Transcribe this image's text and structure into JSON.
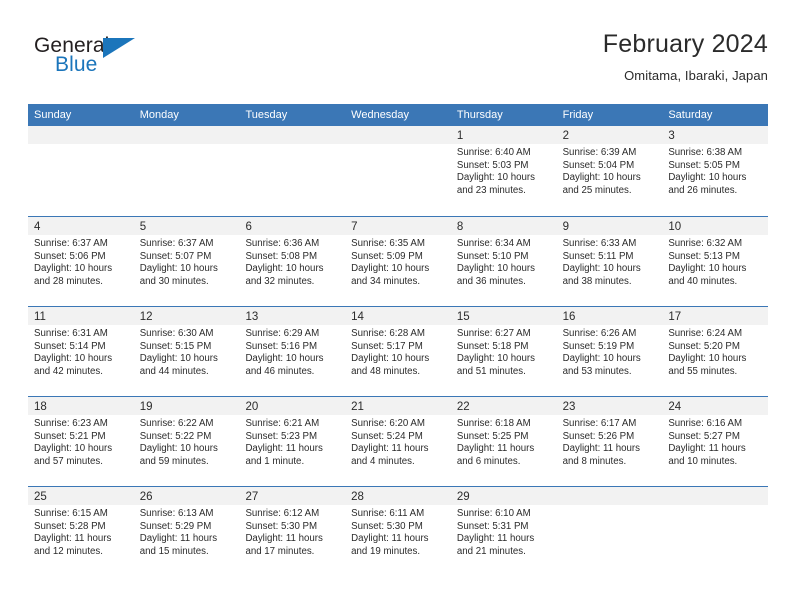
{
  "brand": {
    "name_top": "General",
    "name_bottom": "Blue",
    "triangle_icon": "brand-triangle-icon",
    "color_dark": "#231f20",
    "color_blue": "#1b75bb"
  },
  "header": {
    "title": "February 2024",
    "subtitle": "Omitama, Ibaraki, Japan"
  },
  "theme": {
    "header_blue": "#3b77b6",
    "day_band_gray": "#f2f2f2",
    "text": "#2b2b2b"
  },
  "weekdays": [
    "Sunday",
    "Monday",
    "Tuesday",
    "Wednesday",
    "Thursday",
    "Friday",
    "Saturday"
  ],
  "weeks": [
    [
      {
        "empty": true
      },
      {
        "empty": true
      },
      {
        "empty": true
      },
      {
        "empty": true
      },
      {
        "day": "1",
        "sunrise": "Sunrise: 6:40 AM",
        "sunset": "Sunset: 5:03 PM",
        "daylight": "Daylight: 10 hours and 23 minutes."
      },
      {
        "day": "2",
        "sunrise": "Sunrise: 6:39 AM",
        "sunset": "Sunset: 5:04 PM",
        "daylight": "Daylight: 10 hours and 25 minutes."
      },
      {
        "day": "3",
        "sunrise": "Sunrise: 6:38 AM",
        "sunset": "Sunset: 5:05 PM",
        "daylight": "Daylight: 10 hours and 26 minutes."
      }
    ],
    [
      {
        "day": "4",
        "sunrise": "Sunrise: 6:37 AM",
        "sunset": "Sunset: 5:06 PM",
        "daylight": "Daylight: 10 hours and 28 minutes."
      },
      {
        "day": "5",
        "sunrise": "Sunrise: 6:37 AM",
        "sunset": "Sunset: 5:07 PM",
        "daylight": "Daylight: 10 hours and 30 minutes."
      },
      {
        "day": "6",
        "sunrise": "Sunrise: 6:36 AM",
        "sunset": "Sunset: 5:08 PM",
        "daylight": "Daylight: 10 hours and 32 minutes."
      },
      {
        "day": "7",
        "sunrise": "Sunrise: 6:35 AM",
        "sunset": "Sunset: 5:09 PM",
        "daylight": "Daylight: 10 hours and 34 minutes."
      },
      {
        "day": "8",
        "sunrise": "Sunrise: 6:34 AM",
        "sunset": "Sunset: 5:10 PM",
        "daylight": "Daylight: 10 hours and 36 minutes."
      },
      {
        "day": "9",
        "sunrise": "Sunrise: 6:33 AM",
        "sunset": "Sunset: 5:11 PM",
        "daylight": "Daylight: 10 hours and 38 minutes."
      },
      {
        "day": "10",
        "sunrise": "Sunrise: 6:32 AM",
        "sunset": "Sunset: 5:13 PM",
        "daylight": "Daylight: 10 hours and 40 minutes."
      }
    ],
    [
      {
        "day": "11",
        "sunrise": "Sunrise: 6:31 AM",
        "sunset": "Sunset: 5:14 PM",
        "daylight": "Daylight: 10 hours and 42 minutes."
      },
      {
        "day": "12",
        "sunrise": "Sunrise: 6:30 AM",
        "sunset": "Sunset: 5:15 PM",
        "daylight": "Daylight: 10 hours and 44 minutes."
      },
      {
        "day": "13",
        "sunrise": "Sunrise: 6:29 AM",
        "sunset": "Sunset: 5:16 PM",
        "daylight": "Daylight: 10 hours and 46 minutes."
      },
      {
        "day": "14",
        "sunrise": "Sunrise: 6:28 AM",
        "sunset": "Sunset: 5:17 PM",
        "daylight": "Daylight: 10 hours and 48 minutes."
      },
      {
        "day": "15",
        "sunrise": "Sunrise: 6:27 AM",
        "sunset": "Sunset: 5:18 PM",
        "daylight": "Daylight: 10 hours and 51 minutes."
      },
      {
        "day": "16",
        "sunrise": "Sunrise: 6:26 AM",
        "sunset": "Sunset: 5:19 PM",
        "daylight": "Daylight: 10 hours and 53 minutes."
      },
      {
        "day": "17",
        "sunrise": "Sunrise: 6:24 AM",
        "sunset": "Sunset: 5:20 PM",
        "daylight": "Daylight: 10 hours and 55 minutes."
      }
    ],
    [
      {
        "day": "18",
        "sunrise": "Sunrise: 6:23 AM",
        "sunset": "Sunset: 5:21 PM",
        "daylight": "Daylight: 10 hours and 57 minutes."
      },
      {
        "day": "19",
        "sunrise": "Sunrise: 6:22 AM",
        "sunset": "Sunset: 5:22 PM",
        "daylight": "Daylight: 10 hours and 59 minutes."
      },
      {
        "day": "20",
        "sunrise": "Sunrise: 6:21 AM",
        "sunset": "Sunset: 5:23 PM",
        "daylight": "Daylight: 11 hours and 1 minute."
      },
      {
        "day": "21",
        "sunrise": "Sunrise: 6:20 AM",
        "sunset": "Sunset: 5:24 PM",
        "daylight": "Daylight: 11 hours and 4 minutes."
      },
      {
        "day": "22",
        "sunrise": "Sunrise: 6:18 AM",
        "sunset": "Sunset: 5:25 PM",
        "daylight": "Daylight: 11 hours and 6 minutes."
      },
      {
        "day": "23",
        "sunrise": "Sunrise: 6:17 AM",
        "sunset": "Sunset: 5:26 PM",
        "daylight": "Daylight: 11 hours and 8 minutes."
      },
      {
        "day": "24",
        "sunrise": "Sunrise: 6:16 AM",
        "sunset": "Sunset: 5:27 PM",
        "daylight": "Daylight: 11 hours and 10 minutes."
      }
    ],
    [
      {
        "day": "25",
        "sunrise": "Sunrise: 6:15 AM",
        "sunset": "Sunset: 5:28 PM",
        "daylight": "Daylight: 11 hours and 12 minutes."
      },
      {
        "day": "26",
        "sunrise": "Sunrise: 6:13 AM",
        "sunset": "Sunset: 5:29 PM",
        "daylight": "Daylight: 11 hours and 15 minutes."
      },
      {
        "day": "27",
        "sunrise": "Sunrise: 6:12 AM",
        "sunset": "Sunset: 5:30 PM",
        "daylight": "Daylight: 11 hours and 17 minutes."
      },
      {
        "day": "28",
        "sunrise": "Sunrise: 6:11 AM",
        "sunset": "Sunset: 5:30 PM",
        "daylight": "Daylight: 11 hours and 19 minutes."
      },
      {
        "day": "29",
        "sunrise": "Sunrise: 6:10 AM",
        "sunset": "Sunset: 5:31 PM",
        "daylight": "Daylight: 11 hours and 21 minutes."
      },
      {
        "empty": true
      },
      {
        "empty": true
      }
    ]
  ]
}
